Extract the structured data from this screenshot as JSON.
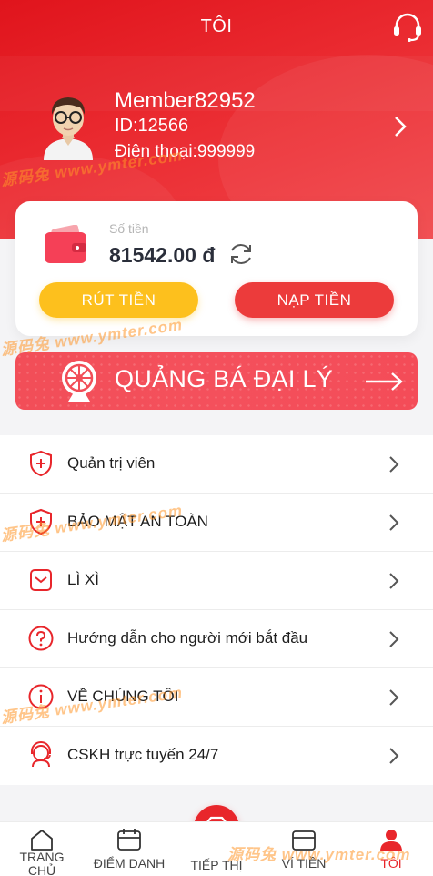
{
  "header": {
    "title": "TÔI",
    "support_icon": "headset-icon",
    "background_color": "#e8262b"
  },
  "profile": {
    "name": "Member82952",
    "id": "ID:12566",
    "phone": "Điện thoại:999999"
  },
  "wallet": {
    "label": "Số tiền",
    "balance": "81542.00 đ",
    "withdraw_label": "RÚT TIỀN",
    "deposit_label": "NẠP TIỀN",
    "withdraw_color": "#fdc01d",
    "deposit_color": "#ec3b3b"
  },
  "promo": {
    "label": "QUẢNG BÁ ĐẠI LÝ"
  },
  "menu": {
    "items": [
      {
        "label": "Quản trị viên",
        "icon": "shield-plus-icon"
      },
      {
        "label": "BẢO MẬT AN TOÀN",
        "icon": "shield-plus-icon"
      },
      {
        "label": "LÌ XÌ",
        "icon": "red-envelope-icon"
      },
      {
        "label": "Hướng dẫn cho người mới bắt đầu",
        "icon": "question-icon"
      },
      {
        "label": "VỀ CHÚNG TÔI",
        "icon": "info-icon"
      },
      {
        "label": "CSKH trực tuyến 24/7",
        "icon": "customer-service-icon"
      }
    ]
  },
  "nav": {
    "items": [
      {
        "label": "TRANG CHỦ",
        "icon": "home-icon"
      },
      {
        "label": "ĐIỂM DANH",
        "icon": "calendar-icon"
      },
      {
        "label": "TIẾP THỊ",
        "icon": "diamond-icon"
      },
      {
        "label": "VÍ TIỀN",
        "icon": "wallet-icon"
      },
      {
        "label": "TÔI",
        "icon": "user-icon"
      }
    ],
    "active_color": "#e8262b"
  },
  "watermark": {
    "text": "源码兔 www.ymter.com"
  }
}
